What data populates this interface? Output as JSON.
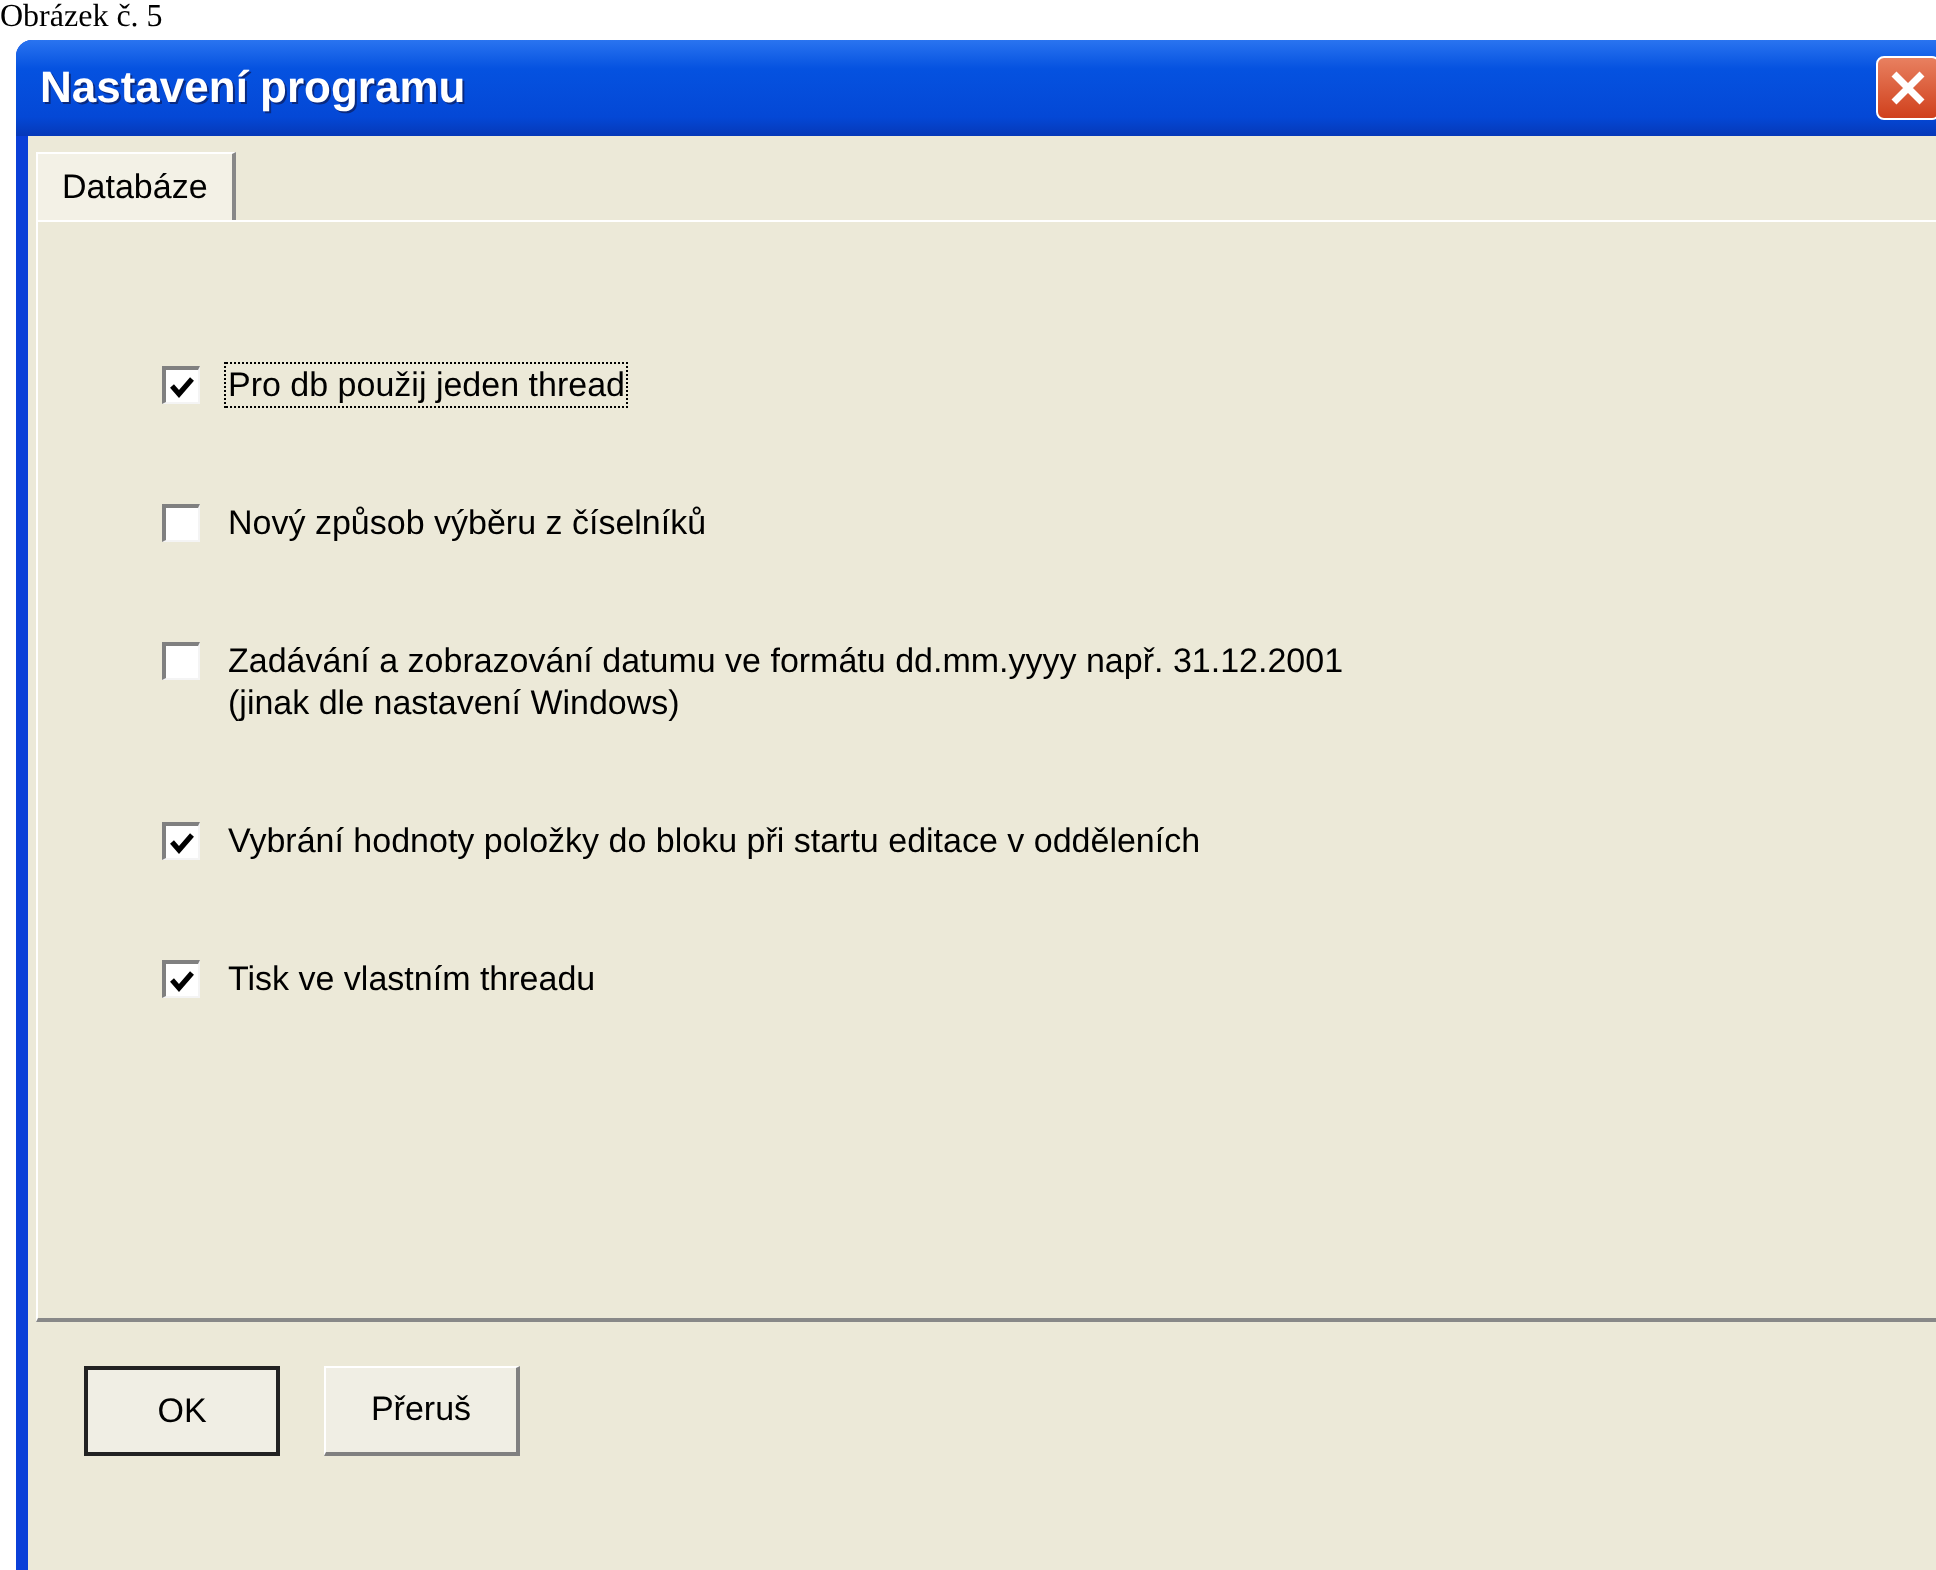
{
  "caption": "Obrázek č. 5",
  "window": {
    "title": "Nastavení programu"
  },
  "tabs": [
    {
      "label": "Databáze",
      "selected": true
    }
  ],
  "options": [
    {
      "label": "Pro db použij jeden thread",
      "checked": true,
      "focused": true
    },
    {
      "label": "Nový způsob výběru z číselníků",
      "checked": false,
      "focused": false
    },
    {
      "label": "Zadávání a zobrazování datumu ve formátu dd.mm.yyyy např. 31.12.2001\n(jinak dle nastavení Windows)",
      "checked": false,
      "focused": false
    },
    {
      "label": "Vybrání hodnoty položky do bloku při startu editace v odděleních",
      "checked": true,
      "focused": false
    },
    {
      "label": "Tisk ve vlastním threadu",
      "checked": true,
      "focused": false
    }
  ],
  "buttons": [
    {
      "label": "OK",
      "default": true
    },
    {
      "label": "Přeruš",
      "default": false
    }
  ]
}
